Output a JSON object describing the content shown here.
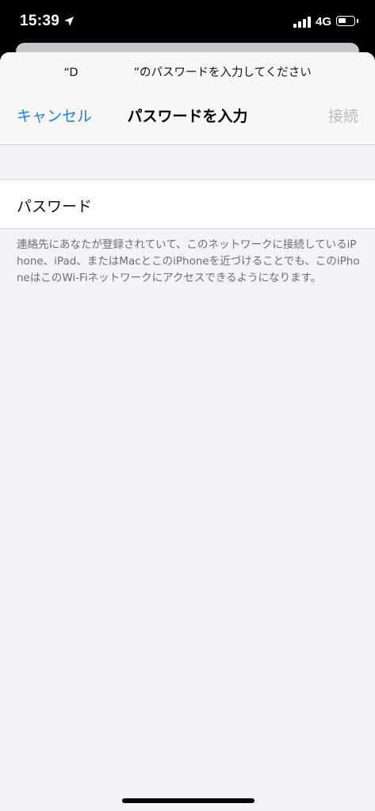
{
  "status_bar": {
    "time": "15:39",
    "network": "4G",
    "location_icon": "location-arrow-icon",
    "signal_icon": "cellular-signal-icon",
    "battery_icon": "battery-icon"
  },
  "dialog": {
    "prompt_open_quote": "“D",
    "prompt_rest": "”のパスワードを入力してください",
    "cancel_label": "キャンセル",
    "title": "パスワードを入力",
    "join_label": "接続"
  },
  "password_field": {
    "label": "パスワード",
    "value": ""
  },
  "footer_note": "連絡先にあなたが登録されていて、このネットワークに接続しているiPhone、iPad、またはMacとこのiPhoneを近づけることでも、このiPhoneはこのWi-Fiネットワークにアクセスできるようになります。",
  "colors": {
    "accent": "#1a7ee0",
    "disabled": "#b9b9bd",
    "background": "#f2f2f7"
  }
}
